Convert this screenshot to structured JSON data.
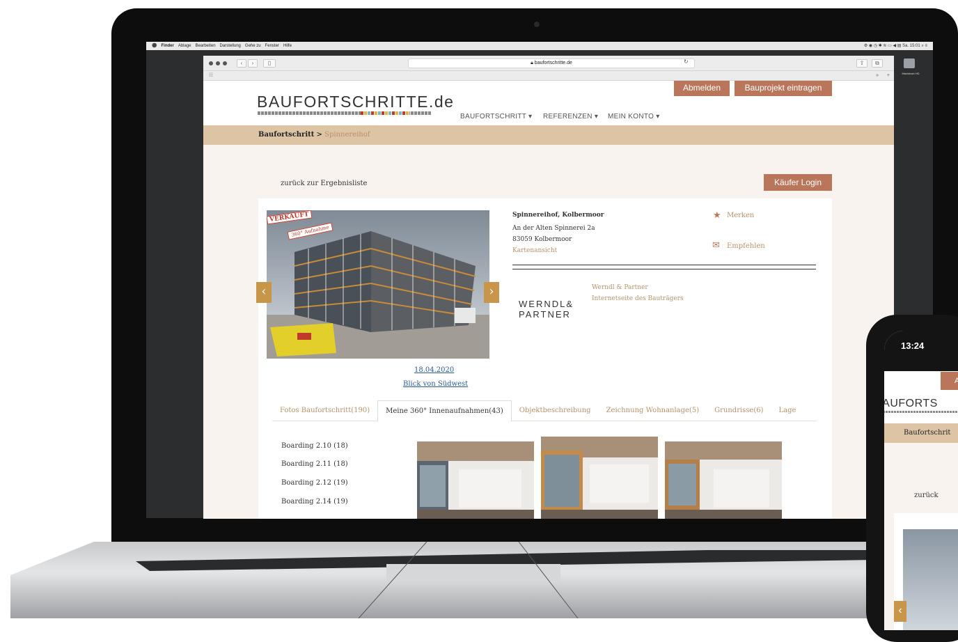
{
  "menubar": {
    "apple": "",
    "items": [
      "Finder",
      "Ablage",
      "Bearbeiten",
      "Darstellung",
      "Gehe zu",
      "Fenster",
      "Hilfe"
    ],
    "clock": "Sa. 15:01"
  },
  "desktop": {
    "hd_label": "Macintosh HD"
  },
  "browser": {
    "url": "baufortschritte.de",
    "favorites_icon": "grid-icon"
  },
  "site": {
    "logo": "BAUFORTSCHRITTE.de",
    "nav": [
      "BAUFORTSCHRITT ▾",
      "REFERENZEN ▾",
      "MEIN KONTO ▾"
    ],
    "logout": "Abmelden",
    "add_project": "Bauprojekt eintragen",
    "breadcrumb_root": "Baufortschritt",
    "breadcrumb_sep": ">",
    "breadcrumb_current": "Spinnereihof",
    "back_link": "zurück zur Ergebnisliste",
    "buyer_login": "Käufer Login"
  },
  "project": {
    "sold_stamp": "VERKAUFT",
    "pano_stamp": "360° Aufnahme",
    "photo_date": "18.04.2020",
    "photo_caption": "Blick von Südwest",
    "title": "Spinnereihof, Kolbermoor",
    "street": "An der Alten Spinnerei 2a",
    "city": "83059 Kolbermoor",
    "map_link": "Kartenansicht",
    "merken": "Merken",
    "empfehlen": "Empfehlen",
    "developer_logo_1": "WERNDL&",
    "developer_logo_2": "PARTNER",
    "developer_name": "Werndl & Partner",
    "developer_link": "Internetseite des Bauträgers"
  },
  "tabs": [
    {
      "label": "Fotos Baufortschritt(190)",
      "active": false
    },
    {
      "label": "Meine 360° Innenaufnahmen(43)",
      "active": true
    },
    {
      "label": "Objektbeschreibung",
      "active": false
    },
    {
      "label": "Zeichnung Wohnanlage(5)",
      "active": false
    },
    {
      "label": "Grundrisse(6)",
      "active": false
    },
    {
      "label": "Lage",
      "active": false
    }
  ],
  "sidebar": [
    "Boarding 2.10 (18)",
    "Boarding 2.11 (18)",
    "Boarding 2.12 (19)",
    "Boarding 2.14 (19)"
  ],
  "phone": {
    "time": "13:24",
    "logo": "BAUFORTS",
    "breadcrumb": "Baufortschrit",
    "back": "zurück",
    "button_letter": "A"
  },
  "colors": {
    "accent": "#b9765a",
    "breadcrumb_bg": "#dcc4a5",
    "arrow": "#c99548",
    "link": "#b7926b"
  }
}
